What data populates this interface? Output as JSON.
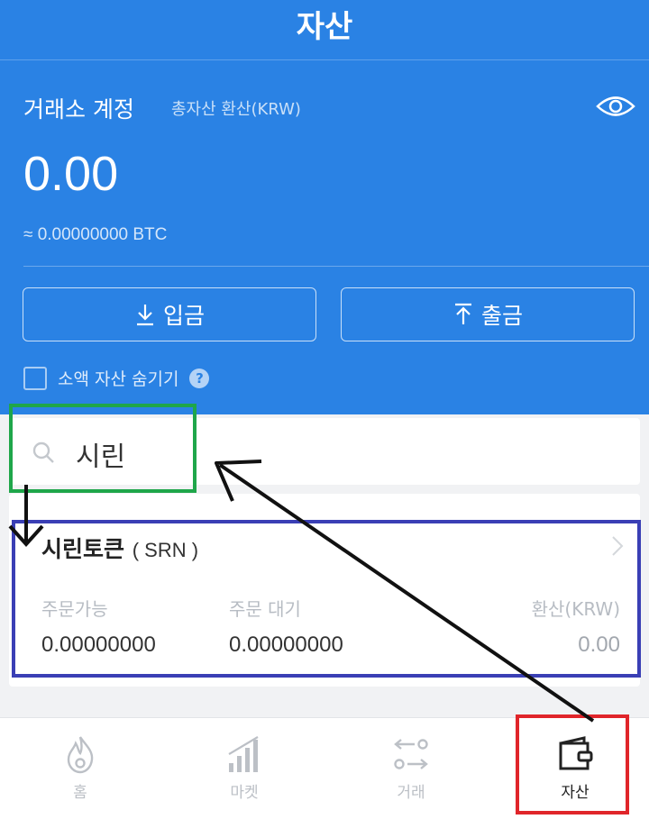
{
  "header": {
    "title": "자산",
    "account_label": "거래소 계정",
    "conversion_label": "총자산 환산(KRW)",
    "balance": "0.00",
    "btc_balance": "≈ 0.00000000 BTC",
    "deposit_label": "입금",
    "withdraw_label": "출금",
    "hide_small_label": "소액 자산 숨기기",
    "help_glyph": "?"
  },
  "search": {
    "query": "시린"
  },
  "asset": {
    "name": "시린토큰",
    "symbol": "( SRN )",
    "available_label": "주문가능",
    "available_value": "0.00000000",
    "pending_label": "주문 대기",
    "pending_value": "0.00000000",
    "krw_label": "환산(KRW)",
    "krw_value": "0.00"
  },
  "tabbar": {
    "tabs": [
      {
        "label": "홈",
        "icon": "flame-icon"
      },
      {
        "label": "마켓",
        "icon": "bar-chart-icon"
      },
      {
        "label": "거래",
        "icon": "exchange-icon"
      },
      {
        "label": "자산",
        "icon": "wallet-icon",
        "active": true
      }
    ]
  },
  "colors": {
    "primary": "#2a82e4",
    "annotation_green": "#1fa64a",
    "annotation_blue": "#3a3fb5",
    "annotation_red": "#e0252a"
  }
}
